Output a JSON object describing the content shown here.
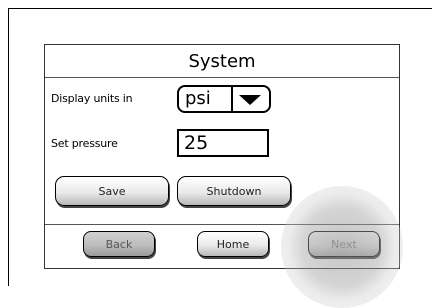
{
  "screen": {
    "title": "System"
  },
  "settings": {
    "display_units_label": "Display units in",
    "display_units_value": "psi",
    "set_pressure_label": "Set pressure",
    "set_pressure_value": "25"
  },
  "actions": {
    "save_label": "Save",
    "shutdown_label": "Shutdown"
  },
  "navigation": {
    "back_label": "Back",
    "home_label": "Home",
    "next_label": "Next"
  },
  "icons": {
    "dropdown": "chevron-down-icon"
  }
}
